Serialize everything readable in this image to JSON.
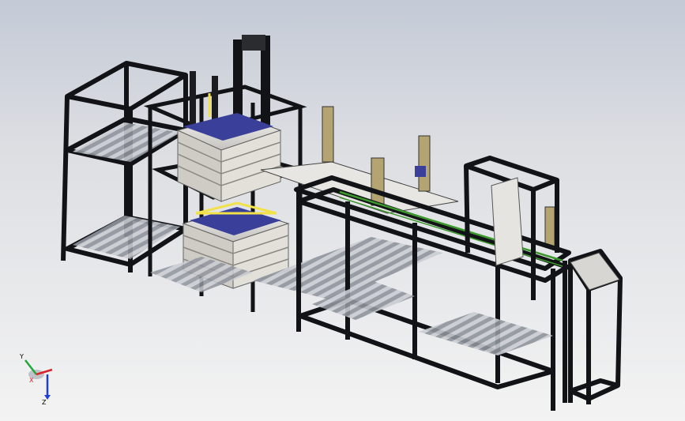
{
  "viewport": {
    "background_top": "#c4cad6",
    "background_bottom": "#f3f3f3"
  },
  "model": {
    "frame_color": "#111317",
    "roller_color": "#b9bec8",
    "panel_color": "#d6d6dc",
    "tray_color": "#ece9e4",
    "blue_panel_color": "#3a3f9a",
    "yellow_edge_color": "#f2e24a",
    "belt_color": "#3c9a2c",
    "post_color": "#b4a472"
  },
  "triad": {
    "x_label": "X",
    "y_label": "Y",
    "z_label": "Z",
    "x_color": "#d8232a",
    "y_color": "#22a83a",
    "z_color": "#1e3fd6"
  }
}
